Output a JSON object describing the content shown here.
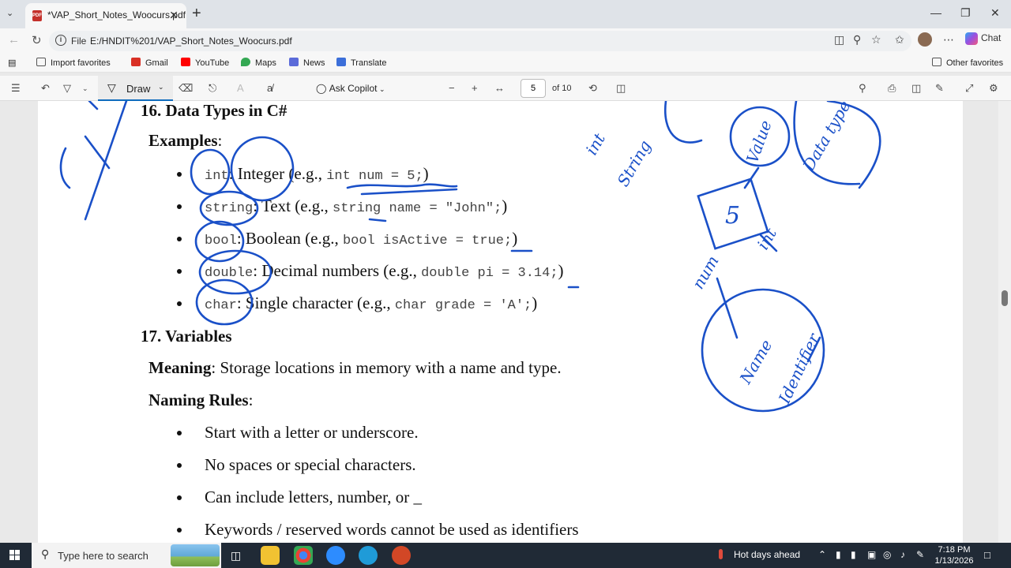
{
  "browser": {
    "tab_title": "*VAP_Short_Notes_Woocurs.pdf",
    "address_label": "File",
    "url": "E:/HNDIT%201/VAP_Short_Notes_Woocurs.pdf",
    "chat_label": "Chat"
  },
  "favorites": [
    "Import favorites",
    "Gmail",
    "YouTube",
    "Maps",
    "News",
    "Translate"
  ],
  "other_favorites": "Other favorites",
  "pdf_toolbar": {
    "draw_label": "Draw",
    "ask_copilot": "Ask Copilot",
    "page_number": "5",
    "page_total": "of 10"
  },
  "document": {
    "heading16": "16. Data Types in C#",
    "examples_label": "Examples",
    "types": [
      {
        "kw": "int",
        "desc": "Integer (e.g., ",
        "code": "int num = 5;",
        "end": ")"
      },
      {
        "kw": "string",
        "desc": "Text (e.g., ",
        "code": "string name = \"John\";",
        "end": ")"
      },
      {
        "kw": "bool",
        "desc": "Boolean (e.g., ",
        "code": "bool isActive = true;",
        "end": ")"
      },
      {
        "kw": "double",
        "desc": "Decimal numbers (e.g., ",
        "code": "double pi = 3.14;",
        "end": ")"
      },
      {
        "kw": "char",
        "desc": "Single character (e.g., ",
        "code": "char grade = 'A';",
        "end": ")"
      }
    ],
    "heading17": "17. Variables",
    "meaning_label": "Meaning",
    "meaning_text": "Storage locations in memory with a name and type.",
    "naming_label": "Naming Rules",
    "rules": [
      "Start with a letter or underscore.",
      "No spaces or special characters.",
      "Can include letters, number, or _",
      "Keywords / reserved words cannot be used as identifiers"
    ]
  },
  "annotations": {
    "ink_color": "#1a50c8",
    "words": [
      "int",
      "String",
      "5",
      "int",
      "num",
      "Value",
      "Data type",
      "Name",
      "Identifier"
    ]
  },
  "taskbar": {
    "search_placeholder": "Type here to search",
    "weather": "Hot days ahead",
    "time": "7:18 PM",
    "date": "1/13/2026"
  }
}
